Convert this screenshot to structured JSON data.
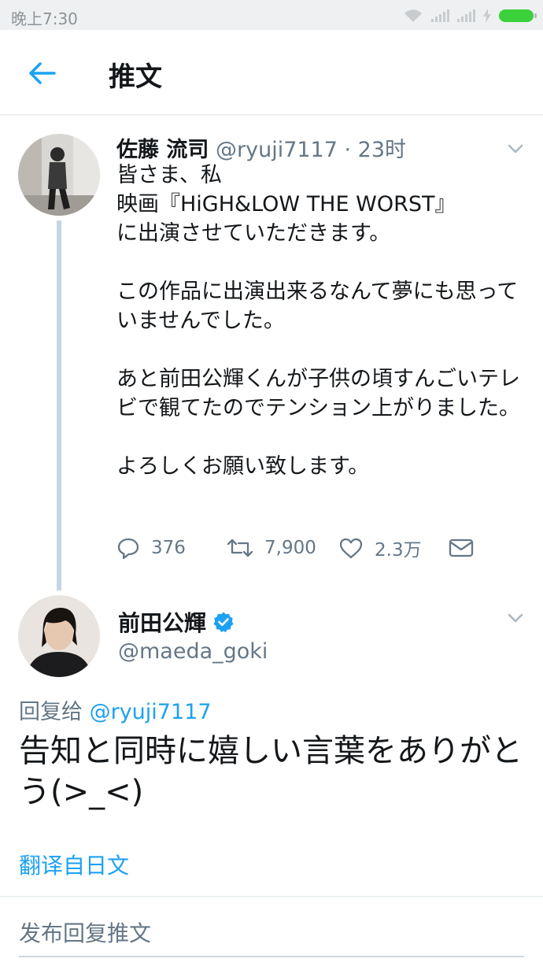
{
  "status_bar": {
    "time": "晚上7:30"
  },
  "header": {
    "title": "推文"
  },
  "tweet1": {
    "name": "佐藤 流司",
    "handle_meta": "@ryuji7117 · 23时",
    "text": "皆さま、私\n映画『HiGH&LOW THE WORST』\nに出演させていただきます。\n\nこの作品に出演出来るなんて夢にも思っていませんでした。\n\nあと前田公輝くんが子供の頃すんごいテレビで観てたのでテンション上がりました。\n\nよろしくお願い致します。",
    "replies": "376",
    "retweets": "7,900",
    "likes": "2.3万"
  },
  "tweet2": {
    "name": "前田公輝",
    "handle": "@maeda_goki",
    "reply_prefix": "回复给 ",
    "reply_handle": "@ryuji7117",
    "text": "告知と同時に嬉しい言葉をありがとう(>_<)"
  },
  "translate_label": "翻译自日文",
  "reply_box": {
    "placeholder": "发布回复推文"
  },
  "colors": {
    "accent": "#1da1f2",
    "verified": "#1da1f2",
    "thread_line": "#c5d6e3",
    "muted": "#657786"
  }
}
